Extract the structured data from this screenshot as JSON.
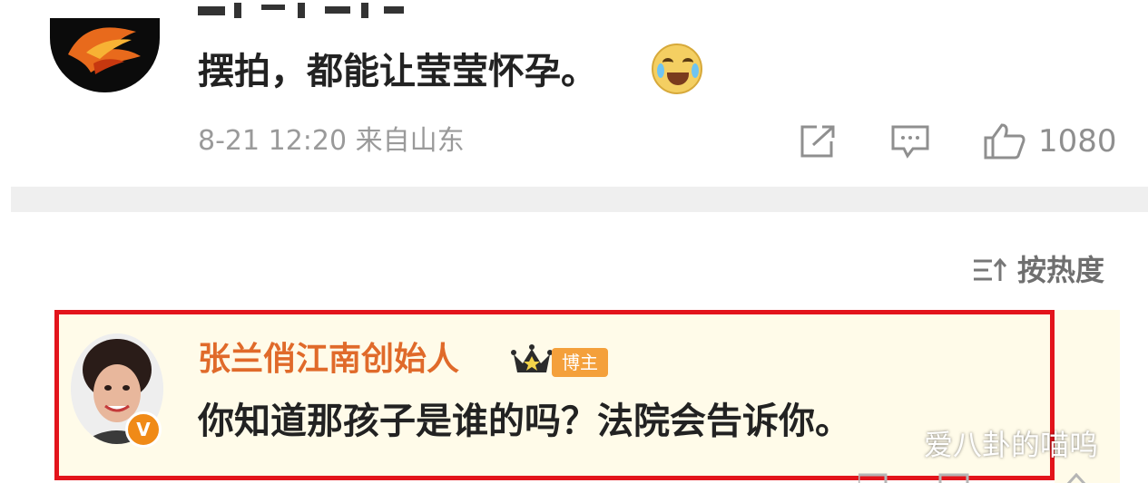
{
  "top_comment": {
    "text": "摆拍，都能让莹莹怀孕。",
    "time_location": "8-21 12:20 来自山东",
    "like_count": "1080",
    "emoji": "laugh-cry-emoji"
  },
  "sort": {
    "label": "按热度"
  },
  "blogger_comment": {
    "name": "张兰俏江南创始人",
    "tag": "博主",
    "text": "你知道那孩子是谁的吗？法院会告诉你。",
    "verified_badge": "V"
  },
  "watermark": "爱八卦的喵呜",
  "colors": {
    "accent_name": "#e06a2a",
    "highlight_border": "#e3141b",
    "highlight_bg": "#fffbe9",
    "badge_orange": "#f08a17"
  },
  "icons": [
    "share-icon",
    "comment-icon",
    "like-icon",
    "sort-icon",
    "crown-icon"
  ]
}
